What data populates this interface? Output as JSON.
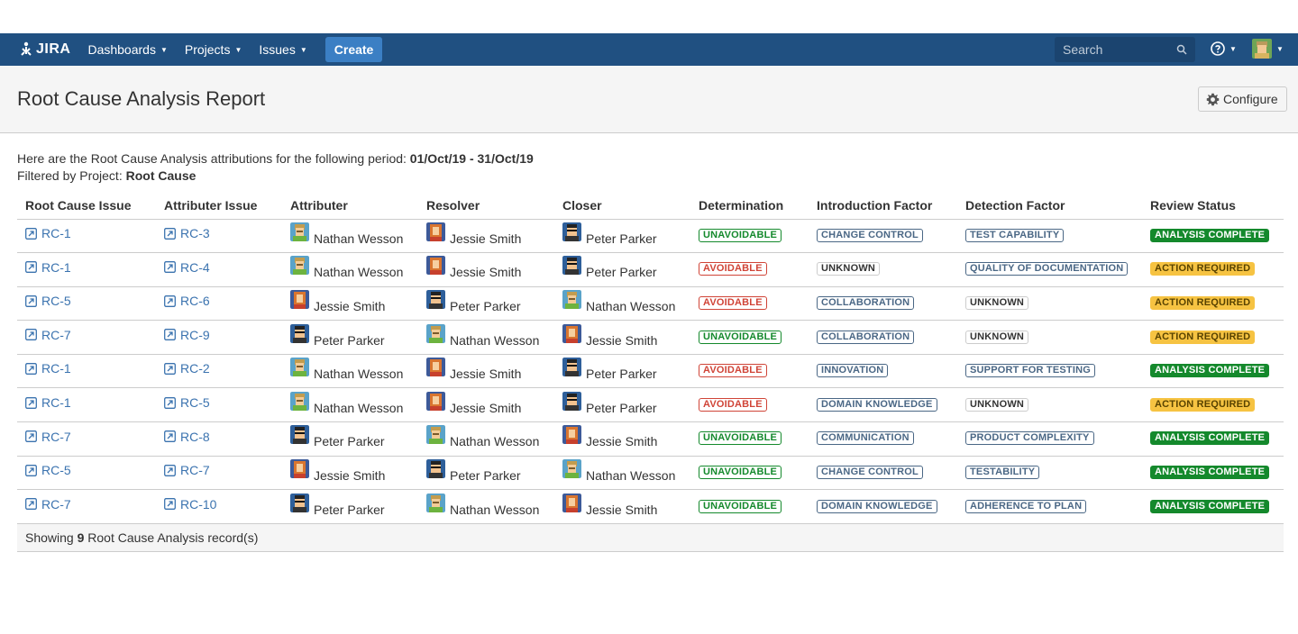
{
  "nav": {
    "logo": "JIRA",
    "dashboards": "Dashboards",
    "projects": "Projects",
    "issues": "Issues",
    "create": "Create",
    "search_placeholder": "Search"
  },
  "header": {
    "title": "Root Cause Analysis Report",
    "configure": "Configure"
  },
  "intro": {
    "line1_prefix": "Here are the Root Cause Analysis attributions for the following period: ",
    "period_start": "01/Oct/19",
    "period_sep": " - ",
    "period_end": "31/Oct/19",
    "line2_prefix": "Filtered by Project: ",
    "project": "Root Cause"
  },
  "columns": [
    "Root Cause Issue",
    "Attributer Issue",
    "Attributer",
    "Resolver",
    "Closer",
    "Determination",
    "Introduction Factor",
    "Detection Factor",
    "Review Status"
  ],
  "rows": [
    {
      "rc": "RC-1",
      "attr_issue": "RC-3",
      "attributer": "Nathan Wesson",
      "resolver": "Jessie Smith",
      "closer": "Peter Parker",
      "determination": "UNAVOIDABLE",
      "intro": "CHANGE CONTROL",
      "detect": "TEST CAPABILITY",
      "status": "ANALYSIS COMPLETE"
    },
    {
      "rc": "RC-1",
      "attr_issue": "RC-4",
      "attributer": "Nathan Wesson",
      "resolver": "Jessie Smith",
      "closer": "Peter Parker",
      "determination": "AVOIDABLE",
      "intro": "UNKNOWN",
      "detect": "QUALITY OF DOCUMENTATION",
      "status": "ACTION REQUIRED"
    },
    {
      "rc": "RC-5",
      "attr_issue": "RC-6",
      "attributer": "Jessie Smith",
      "resolver": "Peter Parker",
      "closer": "Nathan Wesson",
      "determination": "AVOIDABLE",
      "intro": "COLLABORATION",
      "detect": "UNKNOWN",
      "status": "ACTION REQUIRED"
    },
    {
      "rc": "RC-7",
      "attr_issue": "RC-9",
      "attributer": "Peter Parker",
      "resolver": "Nathan Wesson",
      "closer": "Jessie Smith",
      "determination": "UNAVOIDABLE",
      "intro": "COLLABORATION",
      "detect": "UNKNOWN",
      "status": "ACTION REQUIRED"
    },
    {
      "rc": "RC-1",
      "attr_issue": "RC-2",
      "attributer": "Nathan Wesson",
      "resolver": "Jessie Smith",
      "closer": "Peter Parker",
      "determination": "AVOIDABLE",
      "intro": "INNOVATION",
      "detect": "SUPPORT FOR TESTING",
      "status": "ANALYSIS COMPLETE"
    },
    {
      "rc": "RC-1",
      "attr_issue": "RC-5",
      "attributer": "Nathan Wesson",
      "resolver": "Jessie Smith",
      "closer": "Peter Parker",
      "determination": "AVOIDABLE",
      "intro": "DOMAIN KNOWLEDGE",
      "detect": "UNKNOWN",
      "status": "ACTION REQUIRED"
    },
    {
      "rc": "RC-7",
      "attr_issue": "RC-8",
      "attributer": "Peter Parker",
      "resolver": "Nathan Wesson",
      "closer": "Jessie Smith",
      "determination": "UNAVOIDABLE",
      "intro": "COMMUNICATION",
      "detect": "PRODUCT COMPLEXITY",
      "status": "ANALYSIS COMPLETE"
    },
    {
      "rc": "RC-5",
      "attr_issue": "RC-7",
      "attributer": "Jessie Smith",
      "resolver": "Peter Parker",
      "closer": "Nathan Wesson",
      "determination": "UNAVOIDABLE",
      "intro": "CHANGE CONTROL",
      "detect": "TESTABILITY",
      "status": "ANALYSIS COMPLETE"
    },
    {
      "rc": "RC-7",
      "attr_issue": "RC-10",
      "attributer": "Peter Parker",
      "resolver": "Nathan Wesson",
      "closer": "Jessie Smith",
      "determination": "UNAVOIDABLE",
      "intro": "DOMAIN KNOWLEDGE",
      "detect": "ADHERENCE TO PLAN",
      "status": "ANALYSIS COMPLETE"
    }
  ],
  "footer": {
    "prefix": "Showing ",
    "count": "9",
    "suffix": " Root Cause Analysis record(s)"
  },
  "colors": {
    "nav_bg": "#205081",
    "link": "#3b73af",
    "green": "#14892c",
    "red": "#d04437",
    "yellow": "#f6c342",
    "blue_grey": "#4a6785"
  }
}
